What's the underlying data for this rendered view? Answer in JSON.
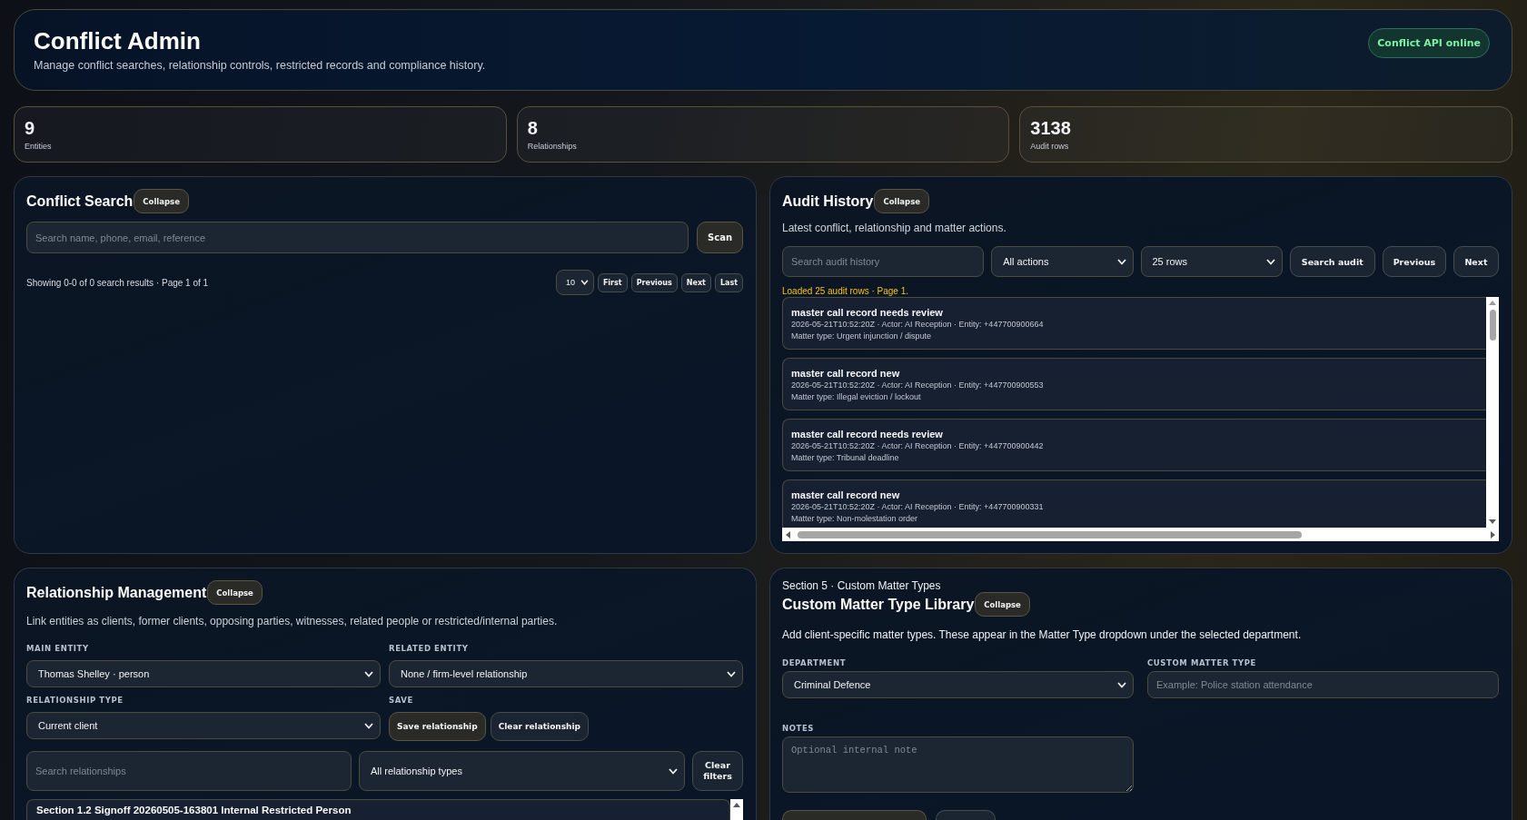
{
  "header": {
    "title": "Conflict Admin",
    "subtitle": "Manage conflict searches, relationship controls, restricted records and compliance history.",
    "status": {
      "label": "Conflict API online",
      "online": true
    }
  },
  "stats": [
    {
      "value": "9",
      "label": "Entities"
    },
    {
      "value": "8",
      "label": "Relationships"
    },
    {
      "value": "3138",
      "label": "Audit rows"
    }
  ],
  "conflict_search": {
    "title": "Conflict Search",
    "collapse_button": "Collapse",
    "search": {
      "placeholder": "Search name, phone, email, reference"
    },
    "scan_button": "Scan",
    "summary": "Showing 0-0 of 0 search results · Page 1 of 1",
    "page_size": "10",
    "pager_buttons": [
      "First",
      "Previous",
      "Next",
      "Last"
    ]
  },
  "audit_history": {
    "title": "Audit History",
    "collapse_button": "Collapse",
    "subtitle": "Latest conflict, relationship and matter actions.",
    "search": {
      "placeholder": "Search audit history"
    },
    "action_filter": "All actions",
    "row_count": "25 rows",
    "buttons": [
      "Search audit",
      "Previous",
      "Next"
    ],
    "status": "Loaded 25 audit rows · Page 1.",
    "entries": [
      {
        "title": "master call record needs review",
        "meta": "2026-05-21T10:52:20Z · Actor: AI Reception · Entity: +447700900664",
        "matter": "Matter type: Urgent injunction / dispute"
      },
      {
        "title": "master call record new",
        "meta": "2026-05-21T10:52:20Z · Actor: AI Reception · Entity: +447700900553",
        "matter": "Matter type: Illegal eviction / lockout"
      },
      {
        "title": "master call record needs review",
        "meta": "2026-05-21T10:52:20Z · Actor: AI Reception · Entity: +447700900442",
        "matter": "Matter type: Tribunal deadline"
      },
      {
        "title": "master call record new",
        "meta": "2026-05-21T10:52:20Z · Actor: AI Reception · Entity: +447700900331",
        "matter": "Matter type: Non-molestation order"
      }
    ]
  },
  "relationship_management": {
    "title": "Relationship Management",
    "collapse_button": "Collapse",
    "description": "Link entities as clients, former clients, opposing parties, witnesses, related people or restricted/internal parties.",
    "main_entity": {
      "label": "MAIN ENTITY",
      "value": "Thomas Shelley · person"
    },
    "related_entity": {
      "label": "RELATED ENTITY",
      "value": "None / firm-level relationship"
    },
    "relationship_type": {
      "label": "RELATIONSHIP TYPE",
      "value": "Current client"
    },
    "save": {
      "label": "SAVE",
      "buttons": [
        {
          "label": "Save relationship",
          "kind": "primary"
        },
        {
          "label": "Clear relationship",
          "kind": "secondary"
        }
      ]
    },
    "filter_search": {
      "placeholder": "Search relationships"
    },
    "type_filter": "All relationship types",
    "clear_filters_button": "Clear filters",
    "records": [
      {
        "title": "Section 1.2 Signoff 20260505-163801 Internal Restricted Person"
      }
    ]
  },
  "custom_matter_types": {
    "section": "Section 5 · Custom Matter Types",
    "title": "Custom Matter Type Library",
    "collapse_button": "Collapse",
    "description": "Add client-specific matter types. These appear in the Matter Type dropdown under the selected department.",
    "department": {
      "label": "DEPARTMENT",
      "value": "Criminal Defence"
    },
    "custom_type": {
      "label": "CUSTOM MATTER TYPE",
      "placeholder": "Example: Police station attendance"
    },
    "notes": {
      "label": "NOTES",
      "placeholder": "Optional internal note"
    },
    "actions": [
      {
        "kind": "primary"
      },
      {
        "kind": "secondary"
      }
    ]
  }
}
